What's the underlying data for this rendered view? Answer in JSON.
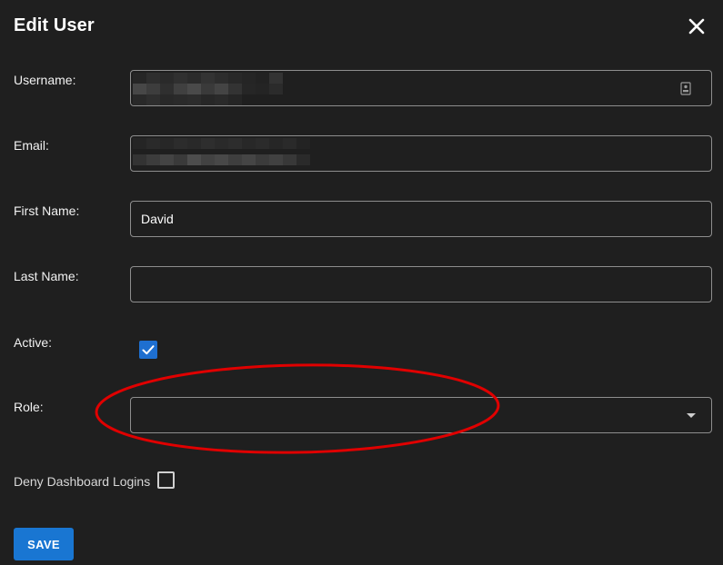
{
  "dialog": {
    "title": "Edit User",
    "close_icon": "close-icon"
  },
  "fields": {
    "username_label": "Username:",
    "email_label": "Email:",
    "first_name_label": "First Name:",
    "first_name_value": "David",
    "last_name_label": "Last Name:",
    "last_name_value": "",
    "active_label": "Active:",
    "active_checked": true,
    "role_label": "Role:",
    "role_value": "",
    "deny_label": "Deny Dashboard Logins",
    "deny_checked": false
  },
  "actions": {
    "save_label": "SAVE"
  },
  "colors": {
    "background": "#1f1f1f",
    "accent": "#1976d2",
    "annotation": "#e00000"
  }
}
